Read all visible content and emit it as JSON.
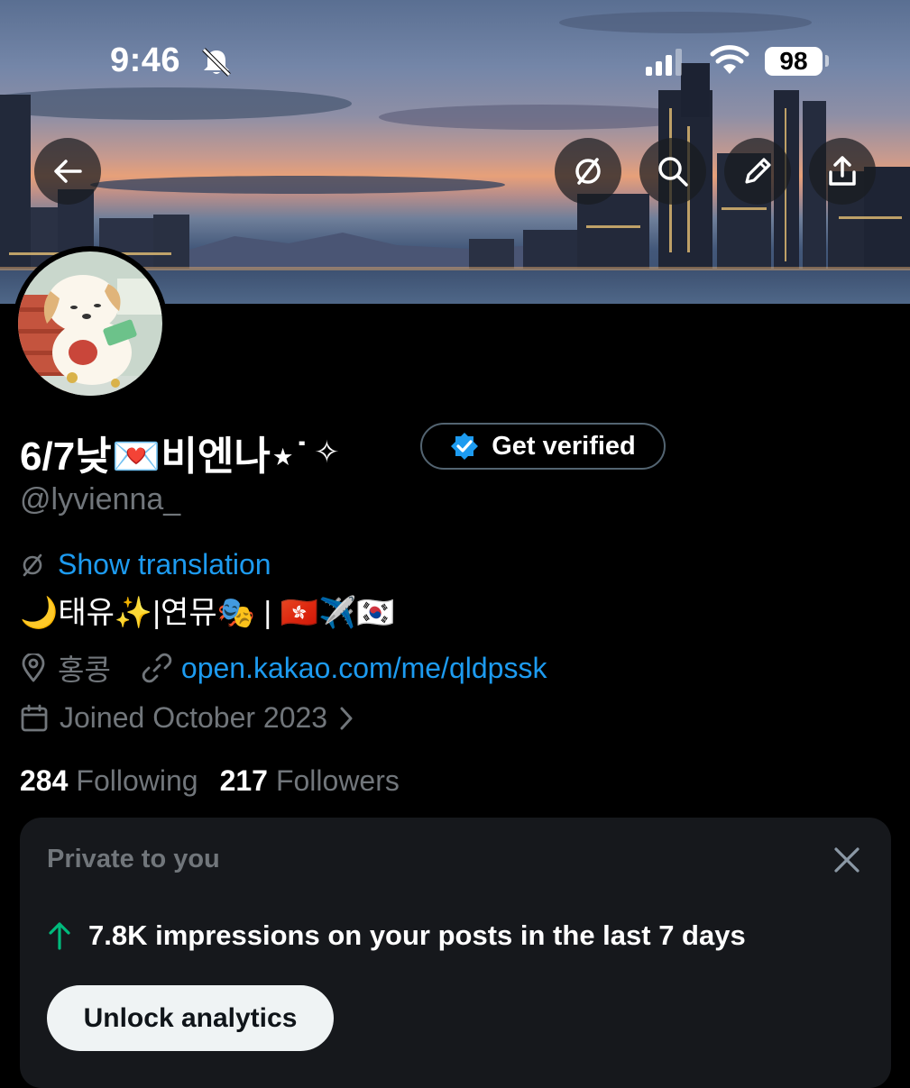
{
  "status_bar": {
    "time": "9:46",
    "battery": "98",
    "icons": [
      "bell-muted-icon",
      "signal-icon",
      "wifi-icon",
      "battery-icon"
    ]
  },
  "header_actions": {
    "icons": [
      "back-arrow-icon",
      "translate-icon",
      "search-icon",
      "edit-pencil-icon",
      "share-upload-icon"
    ]
  },
  "profile": {
    "display_name": "6/7낮💌비엔나⋆˙",
    "name_sparkle": "✧",
    "verify_label": "Get verified",
    "handle": "@lyvienna_",
    "translation_link": "Show translation",
    "bio": "🌙태유✨|연뮤🎭 | 🇭🇰✈️🇰🇷",
    "location": "홍콩",
    "url": "open.kakao.com/me/qldpssk",
    "joined": "Joined October 2023"
  },
  "counts": {
    "following_num": "284",
    "following_label": "Following",
    "followers_num": "217",
    "followers_label": "Followers"
  },
  "private_card": {
    "title": "Private to you",
    "stat": "7.8K impressions on your posts in the last 7 days",
    "button": "Unlock analytics"
  },
  "colors": {
    "background": "#000000",
    "link_blue": "#1d9bf0",
    "secondary_text": "#71767b",
    "verified_badge": "#1d9bf0",
    "up_arrow_green": "#00ba7c",
    "card_bg": "#16181c"
  }
}
